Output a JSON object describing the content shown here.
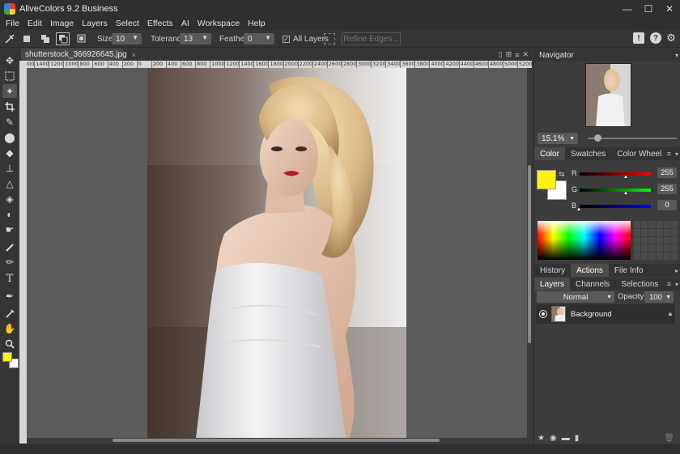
{
  "app": {
    "title": "AliveColors 9.2 Business",
    "window_controls": [
      "—",
      "☐",
      "✕"
    ]
  },
  "menu": [
    "File",
    "Edit",
    "Image",
    "Layers",
    "Select",
    "Effects",
    "AI",
    "Workspace",
    "Help"
  ],
  "options": {
    "size_label": "Size",
    "size_value": "10",
    "tolerance_label": "Tolerance",
    "tolerance_value": "13",
    "feather_label": "Feather",
    "feather_value": "0",
    "all_layers_label": "All Layers",
    "all_layers_checked": true,
    "refine_edges_label": "Refine Edges..."
  },
  "document": {
    "tab_name": "shutterstock_366926645.jpg",
    "ruler_marks": [
      "1600",
      "1400",
      "1200",
      "1000",
      "800",
      "600",
      "400",
      "200",
      "0",
      "200",
      "400",
      "600",
      "800",
      "1000",
      "1200",
      "1400",
      "1600",
      "1800",
      "2000",
      "2200",
      "2400",
      "2600",
      "2800",
      "3000",
      "3200",
      "3400",
      "3600",
      "3800",
      "4000",
      "4200",
      "4400",
      "4600",
      "4800",
      "5000",
      "5200"
    ]
  },
  "colors": {
    "foreground": "#fff10f",
    "background": "#ffffff",
    "ui_bg": "#3a3a3a"
  },
  "navigator": {
    "title": "Navigator",
    "zoom": "15.1%"
  },
  "color_panel": {
    "tabs": [
      "Color",
      "Swatches",
      "Color Wheel"
    ],
    "active_tab": "Color",
    "r_label": "R",
    "g_label": "G",
    "b_label": "B",
    "r_value": "255",
    "g_value": "255",
    "b_value": "0"
  },
  "history_panel": {
    "tabs": [
      "History",
      "Actions",
      "File Info"
    ],
    "active_tab": "Actions"
  },
  "layers_panel": {
    "tabs": [
      "Layers",
      "Channels",
      "Selections"
    ],
    "active_tab": "Layers",
    "blend_mode": "Normal",
    "opacity_label": "Opacity:",
    "opacity_value": "100",
    "layers": [
      {
        "name": "Background",
        "visible": true,
        "locked": true
      }
    ]
  },
  "icons": {
    "toolbar": [
      "move-icon",
      "marquee-icon",
      "magic-wand-icon",
      "crop-icon",
      "healing-brush-icon",
      "color-replace-icon",
      "eraser-icon",
      "clone-stamp-icon",
      "sharpen-icon",
      "paint-bucket-icon",
      "dodge-icon",
      "smudge-icon",
      "brush-icon",
      "pencil-icon",
      "text-icon",
      "pen-icon",
      "eyedropper-icon",
      "hand-icon",
      "zoom-icon"
    ]
  }
}
